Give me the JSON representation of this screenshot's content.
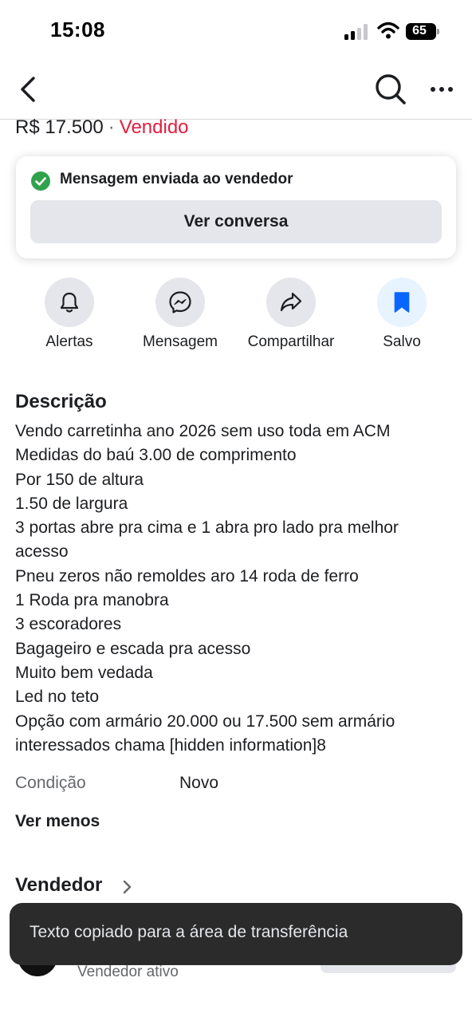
{
  "status_bar": {
    "time": "15:08",
    "battery_level": "65",
    "icons": [
      "signal-icon",
      "wifi-icon",
      "battery-icon"
    ]
  },
  "nav": {
    "icons": [
      "back-arrow-icon",
      "search-icon",
      "more-options-icon"
    ]
  },
  "listing": {
    "price": "R$ 17.500",
    "separator": "·",
    "status": "Vendido",
    "status_color": "#e41e3f"
  },
  "message_card": {
    "text": "Mensagem enviada ao vendedor",
    "button_label": "Ver conversa",
    "check_color": "#31a24c"
  },
  "actions": [
    {
      "label": "Alertas",
      "icon": "bell-icon"
    },
    {
      "label": "Mensagem",
      "icon": "messenger-icon"
    },
    {
      "label": "Compartilhar",
      "icon": "share-arrow-icon"
    },
    {
      "label": "Salvo",
      "icon": "bookmark-icon",
      "active": true,
      "color": "#0866ff"
    }
  ],
  "description": {
    "title": "Descrição",
    "lines": [
      "Vendo carretinha ano 2026 sem uso  toda em ACM",
      "Medidas do baú  3.00 de comprimento",
      "Por 150 de altura",
      "1.50 de largura",
      "3 portas abre pra cima e 1 abra pro lado pra melhor",
      "acesso",
      "Pneu zeros  não remoldes aro 14 roda de ferro",
      "1 Roda pra manobra",
      "3 escoradores",
      "Bagageiro e escada pra acesso",
      "Muito bem vedada",
      "Led no teto",
      "Opção com armário  20.000 ou 17.500  sem armário",
      "interessados chama [hidden information]8"
    ]
  },
  "condition": {
    "label": "Condição",
    "value": "Novo"
  },
  "see_less": "Ver menos",
  "seller": {
    "title": "Vendedor",
    "status": "Vendedor ativo"
  },
  "toast": {
    "text": "Texto copiado para a área de transferência"
  }
}
